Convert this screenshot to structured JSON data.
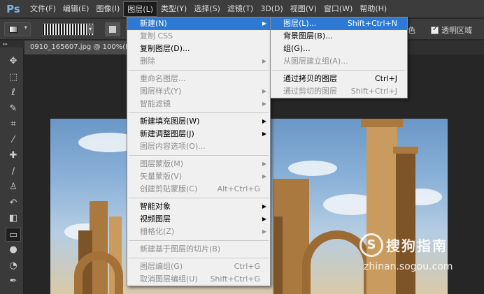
{
  "app": {
    "logo": "Ps"
  },
  "menubar": [
    {
      "label": "文件(F)"
    },
    {
      "label": "编辑(E)"
    },
    {
      "label": "图像(I)"
    },
    {
      "label": "图层(L)",
      "active": true
    },
    {
      "label": "类型(Y)"
    },
    {
      "label": "选择(S)"
    },
    {
      "label": "滤镜(T)"
    },
    {
      "label": "3D(D)"
    },
    {
      "label": "视图(V)"
    },
    {
      "label": "窗口(W)"
    },
    {
      "label": "帮助(H)"
    }
  ],
  "options": {
    "simulate_label": "仿色",
    "transparency_label": "透明区域"
  },
  "document": {
    "tab_title": "0910_165607.jpg @ 100%(R"
  },
  "layer_menu": {
    "groups": [
      [
        {
          "label": "新建(N)",
          "submenu": true,
          "highlight": true
        },
        {
          "label": "复制 CSS",
          "disabled": true
        },
        {
          "label": "复制图层(D)..."
        },
        {
          "label": "删除",
          "submenu": true,
          "disabled": true
        }
      ],
      [
        {
          "label": "重命名图层...",
          "disabled": true
        },
        {
          "label": "图层样式(Y)",
          "submenu": true,
          "disabled": true
        },
        {
          "label": "智能滤镜",
          "submenu": true,
          "disabled": true
        }
      ],
      [
        {
          "label": "新建填充图层(W)",
          "submenu": true
        },
        {
          "label": "新建调整图层(J)",
          "submenu": true
        },
        {
          "label": "图层内容选项(O)...",
          "disabled": true
        }
      ],
      [
        {
          "label": "图层蒙版(M)",
          "submenu": true,
          "disabled": true
        },
        {
          "label": "矢量蒙版(V)",
          "submenu": true,
          "disabled": true
        },
        {
          "label": "创建剪贴蒙版(C)",
          "shortcut": "Alt+Ctrl+G",
          "disabled": true
        }
      ],
      [
        {
          "label": "智能对象",
          "submenu": true
        },
        {
          "label": "视频图层",
          "submenu": true
        },
        {
          "label": "栅格化(Z)",
          "submenu": true,
          "disabled": true
        }
      ],
      [
        {
          "label": "新建基于图层的切片(B)",
          "disabled": true
        }
      ],
      [
        {
          "label": "图层编组(G)",
          "shortcut": "Ctrl+G",
          "disabled": true
        },
        {
          "label": "取消图层编组(U)",
          "shortcut": "Shift+Ctrl+G",
          "disabled": true
        }
      ]
    ]
  },
  "new_submenu": {
    "groups": [
      [
        {
          "label": "图层(L)...",
          "shortcut": "Shift+Ctrl+N",
          "highlight": true
        },
        {
          "label": "背景图层(B)..."
        },
        {
          "label": "组(G)..."
        },
        {
          "label": "从图层建立组(A)...",
          "disabled": true
        }
      ],
      [
        {
          "label": "通过拷贝的图层",
          "shortcut": "Ctrl+J"
        },
        {
          "label": "通过剪切的图层",
          "shortcut": "Shift+Ctrl+J",
          "disabled": true
        }
      ]
    ]
  },
  "tools": [
    {
      "icon": "move-tool-icon",
      "glyph": "✥"
    },
    {
      "icon": "marquee-tool-icon",
      "glyph": "⬚"
    },
    {
      "icon": "lasso-tool-icon",
      "glyph": "ℓ"
    },
    {
      "icon": "quick-select-tool-icon",
      "glyph": "✎"
    },
    {
      "icon": "crop-tool-icon",
      "glyph": "⌗"
    },
    {
      "icon": "eyedropper-tool-icon",
      "glyph": "⁄"
    },
    {
      "icon": "healing-brush-tool-icon",
      "glyph": "✚"
    },
    {
      "icon": "brush-tool-icon",
      "glyph": "∕"
    },
    {
      "icon": "stamp-tool-icon",
      "glyph": "♙"
    },
    {
      "icon": "history-brush-tool-icon",
      "glyph": "↶"
    },
    {
      "icon": "eraser-tool-icon",
      "glyph": "◧"
    },
    {
      "icon": "gradient-tool-icon",
      "glyph": "▭",
      "selected": true
    },
    {
      "icon": "blur-tool-icon",
      "glyph": "●"
    },
    {
      "icon": "dodge-tool-icon",
      "glyph": "◔"
    },
    {
      "icon": "pen-tool-icon",
      "glyph": "✒"
    }
  ],
  "watermark": {
    "logo": "S",
    "title": "搜狗指南",
    "url": "zhinan.sogou.com"
  }
}
